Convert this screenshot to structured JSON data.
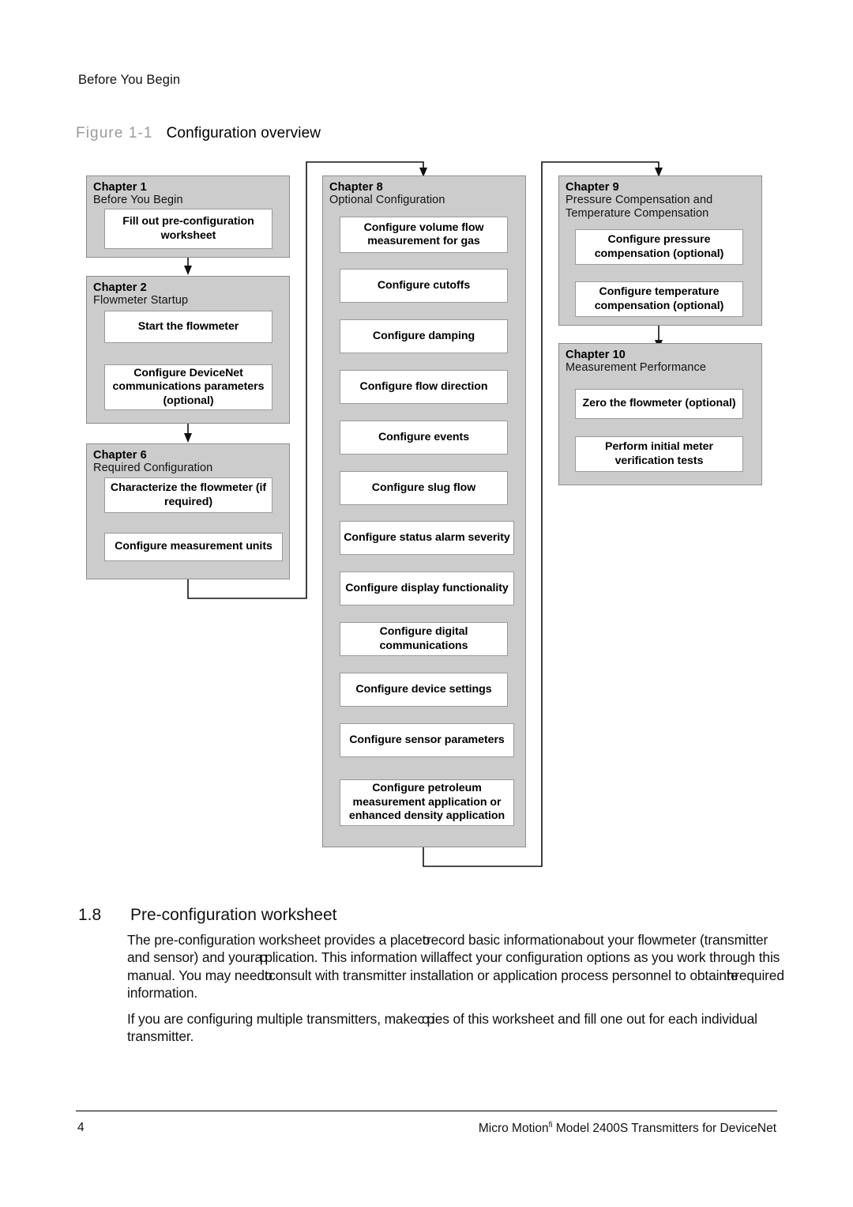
{
  "page": {
    "running_header": "Before You Begin",
    "figure_number": "Figure 1-1",
    "figure_title": "Configuration overview"
  },
  "colors": {
    "group_fill": "#cccccc",
    "group_border": "#8d8d8d",
    "step_fill": "#ffffff",
    "step_border": "#9a9a9a",
    "connector": "#111111",
    "figure_number_gray": "#9a9a9a"
  },
  "flowchart": {
    "columns": [
      {
        "id": "column-1",
        "groups": [
          {
            "chapter": "Chapter 1",
            "subtitle": "Before You Begin",
            "steps": [
              "Fill out pre-configuration worksheet"
            ]
          },
          {
            "chapter": "Chapter 2",
            "subtitle": "Flowmeter Startup",
            "steps": [
              "Start the flowmeter",
              "Configure DeviceNet communications parameters (optional)"
            ]
          },
          {
            "chapter": "Chapter 6",
            "subtitle": "Required Configuration",
            "steps": [
              "Characterize the flowmeter (if required)",
              "Configure measurement units"
            ]
          }
        ]
      },
      {
        "id": "column-2",
        "groups": [
          {
            "chapter": "Chapter 8",
            "subtitle": "Optional Configuration",
            "steps": [
              "Configure volume flow measurement for gas",
              "Configure cutoffs",
              "Configure damping",
              "Configure flow direction",
              "Configure events",
              "Configure slug flow",
              "Configure status alarm severity",
              "Configure display functionality",
              "Configure digital communications",
              "Configure device settings",
              "Configure sensor parameters",
              "Configure petroleum measurement application or enhanced density application"
            ]
          }
        ]
      },
      {
        "id": "column-3",
        "groups": [
          {
            "chapter": "Chapter 9",
            "subtitle": "Pressure Compensation and Temperature Compensation",
            "steps": [
              "Configure pressure compensation (optional)",
              "Configure temperature compensation (optional)"
            ]
          },
          {
            "chapter": "Chapter 10",
            "subtitle": "Measurement Performance",
            "steps": [
              "Zero the flowmeter (optional)",
              "Perform initial meter verification tests"
            ]
          }
        ]
      }
    ]
  },
  "section": {
    "number": "1.8",
    "title": "Pre-configuration worksheet",
    "paragraph_1_parts": {
      "a": "The pre-configuration worksheet provides a place",
      "b": "to",
      "c": "record basic information",
      "d": "",
      "e": "about your flowmeter (transmitter and sensor) and your",
      "f": "ap",
      "g": "plication. This information will",
      "h": "",
      "i": "affect your configuration options as you work through this manual. You may need",
      "j": "to",
      "k": "consult with transmitter in",
      "l": "",
      "m": "stallation or application process personnel to obtain",
      "n": "the",
      "o": "required information."
    },
    "paragraph_2_parts": {
      "a": "If you are configuring multiple transmitters, make",
      "b": "cop",
      "c": "ies of this worksheet and fill one out for each individual transmitter."
    }
  },
  "footer": {
    "page_number": "4",
    "title_before": "Micro Motion",
    "title_mark": "fi",
    "title_after": " Model 2400S Transmitters for DeviceNet"
  }
}
